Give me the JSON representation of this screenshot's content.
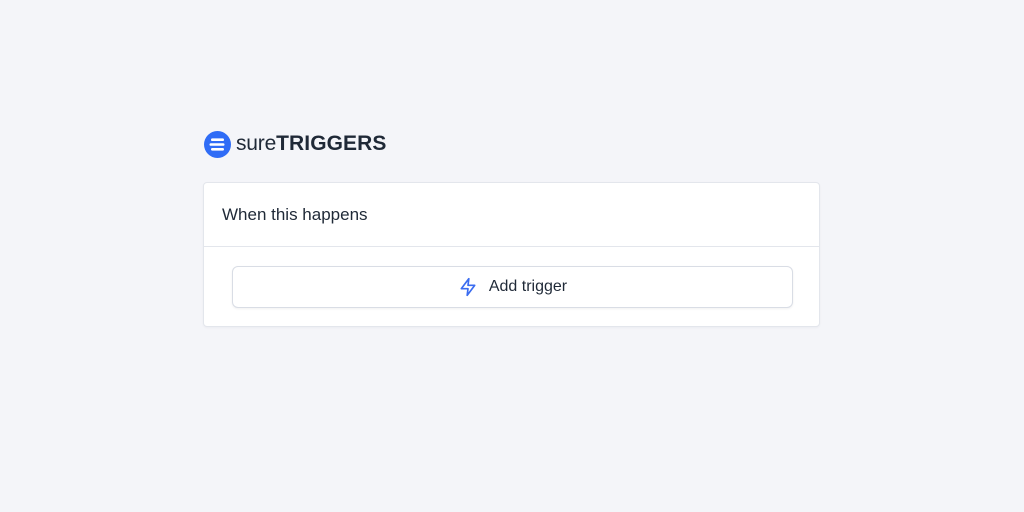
{
  "brand": {
    "name_light": "sure",
    "name_bold": "TRIGGERS",
    "logo_icon": "suretriggers-logo-icon",
    "accent_color": "#2f6cf6"
  },
  "card": {
    "title": "When this happens",
    "add_button": {
      "label": "Add trigger",
      "icon": "lightning-bolt-icon",
      "icon_color": "#3b6cf0"
    }
  }
}
